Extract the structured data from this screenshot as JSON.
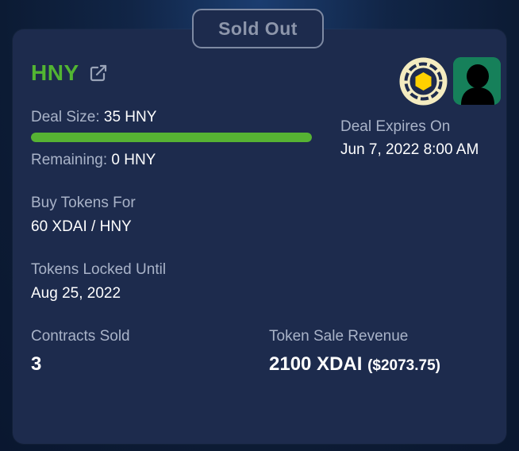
{
  "status": {
    "label": "Sold Out"
  },
  "token": {
    "symbol": "HNY"
  },
  "colors": {
    "accent_green": "#52b532",
    "card_bg": "#1d2b4d",
    "avatar_bg": "#16805a"
  },
  "icons": {
    "external_link": "external-link-icon",
    "token_logo": "honey-coin-icon",
    "project_avatar": "silhouette-avatar-icon"
  },
  "deal": {
    "size_label": "Deal Size:",
    "size_value": "35 HNY",
    "progress_percent": 100,
    "remaining_label": "Remaining:",
    "remaining_value": "0 HNY",
    "expires_label": "Deal Expires On",
    "expires_value": "Jun 7, 2022 8:00 AM"
  },
  "pricing": {
    "buy_label": "Buy Tokens For",
    "buy_value": "60 XDAI / HNY"
  },
  "lock": {
    "label": "Tokens Locked Until",
    "value": "Aug 25, 2022"
  },
  "stats": {
    "contracts_label": "Contracts Sold",
    "contracts_value": "3",
    "revenue_label": "Token Sale Revenue",
    "revenue_value": "2100 XDAI",
    "revenue_usd": "($2073.75)"
  }
}
